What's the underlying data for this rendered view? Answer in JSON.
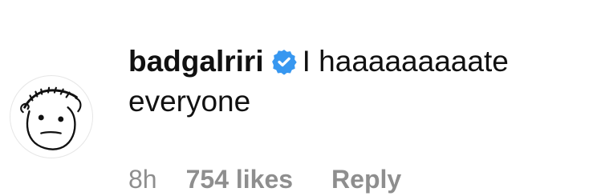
{
  "comment": {
    "username": "badgalriri",
    "verified_icon": "verified-badge-icon",
    "text": "I haaaaaaaaate everyone",
    "avatar_icon": "stick-figure-face-icon"
  },
  "meta": {
    "time": "8h",
    "likes": "754 likes",
    "reply": "Reply"
  },
  "colors": {
    "text": "#111111",
    "meta": "#8e8e8e",
    "verified": "#3797f0",
    "background": "#ffffff"
  }
}
